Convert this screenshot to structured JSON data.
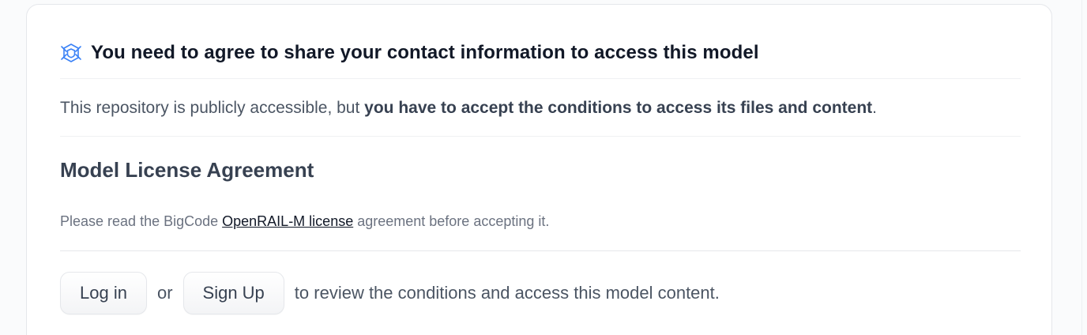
{
  "gate": {
    "icon": "shield-gate-icon",
    "title": "You need to agree to share your contact information to access this model"
  },
  "notice": {
    "prefix": "This repository is publicly accessible, but ",
    "emphasis": "you have to accept the conditions to access its files and content",
    "suffix": "."
  },
  "license": {
    "heading": "Model License Agreement",
    "text_before": "Please read the BigCode ",
    "link_text": "OpenRAIL-M license",
    "text_after": " agreement before accepting it."
  },
  "actions": {
    "login_label": "Log in",
    "or_text": "or",
    "signup_label": "Sign Up",
    "tail_text": "to review the conditions and access this model content."
  },
  "colors": {
    "accent_icon": "#3b82f6",
    "title_text": "#111827",
    "body_text": "#4b5563",
    "muted_text": "#6b7280"
  }
}
